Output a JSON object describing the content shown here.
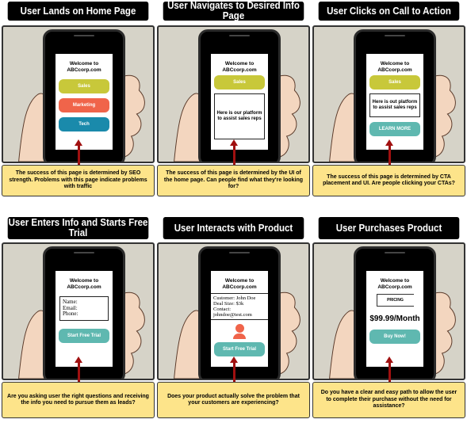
{
  "colors": {
    "title_bg": "#000000",
    "caption_bg": "#fde48a",
    "scene_bg": "#d6d3c8",
    "arrow": "#a01010",
    "sales": "#c8c83a",
    "marketing": "#f0644a",
    "tech": "#1a8aab",
    "cta": "#5fb8b0",
    "skin": "#f3d6bf"
  },
  "site_name": "Welcome to ABCcorp.com",
  "panels": [
    {
      "title": "User Lands on Home Page",
      "screen": {
        "buttons": [
          "Sales",
          "Marketing",
          "Tech"
        ]
      },
      "caption": "The success of this page is determined by SEO strength. Problems with this page indicate problems with traffic"
    },
    {
      "title": "User Navigates to Desired Info Page",
      "screen": {
        "buttons": [
          "Sales"
        ],
        "box_text": "Here is our platform to assist sales reps"
      },
      "caption": "The success of this page is determined by the UI of the home page. Can people find what they're looking for?"
    },
    {
      "title": "User Clicks on Call to Action",
      "screen": {
        "buttons": [
          "Sales"
        ],
        "box_text": "Here is out platform to assist sales reps",
        "cta": "LEARN MORE"
      },
      "caption": "The success of this page is determined by CTA placement and UI. Are people clicking your CTAs?"
    },
    {
      "title": "User Enters Info and Starts Free Trial",
      "screen": {
        "form_fields": [
          "Name:",
          "Email:",
          "Phone:"
        ],
        "cta": "Start Free Trial"
      },
      "caption": "Are you asking user the right questions and receiving the info you need to pursue them as leads?"
    },
    {
      "title": "User Interacts with Product",
      "screen": {
        "info_lines": [
          "Customer: John Doe",
          "Deal Size: $3k",
          "Contact:",
          "johndoe@test.com"
        ],
        "icon": "person-icon",
        "cta": "Start Free Trial"
      },
      "caption": "Does your product actually solve the problem that your customers are experiencing?"
    },
    {
      "title": "User Purchases Product",
      "screen": {
        "tab": "PRICING",
        "price": "$99.99/Month",
        "cta": "Buy Now!"
      },
      "caption": "Do you have a clear and easy path to allow the user to complete their purchase without the need for assistance?"
    }
  ]
}
